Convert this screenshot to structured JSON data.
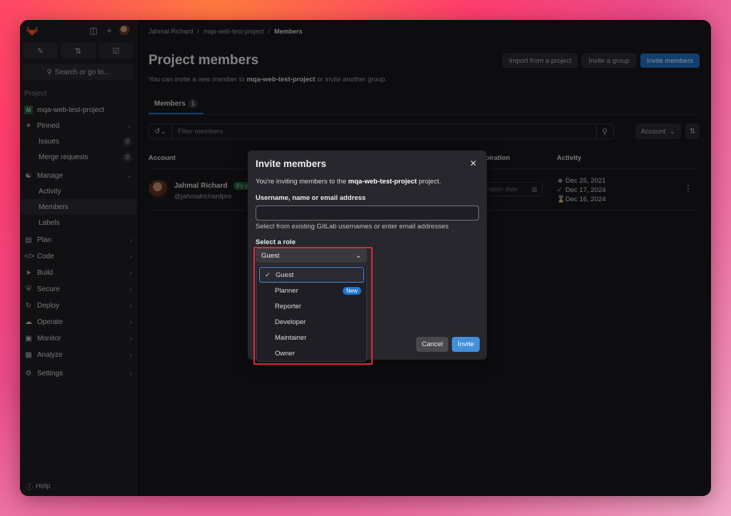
{
  "sidebar": {
    "search_label": "Search or go to...",
    "section_label": "Project",
    "project_name": "mqa-web-test-project",
    "project_initial": "M",
    "pinned_label": "Pinned",
    "issues_label": "Issues",
    "issues_count": "0",
    "mr_label": "Merge requests",
    "mr_count": "0",
    "manage_label": "Manage",
    "activity_label": "Activity",
    "members_label": "Members",
    "labels_label": "Labels",
    "plan_label": "Plan",
    "code_label": "Code",
    "build_label": "Build",
    "secure_label": "Secure",
    "deploy_label": "Deploy",
    "operate_label": "Operate",
    "monitor_label": "Monitor",
    "analyze_label": "Analyze",
    "settings_label": "Settings",
    "help_label": "Help"
  },
  "breadcrumb": {
    "user": "Jahmal Richard",
    "project": "mqa-web-test-project",
    "current": "Members"
  },
  "header": {
    "title": "Project members",
    "import_label": "Import from a project",
    "invite_group_label": "Invite a group",
    "invite_members_label": "Invite members",
    "subtitle_pre": "You can invite a new member to ",
    "subtitle_project": "mqa-web-test-project",
    "subtitle_post": " or invite another group."
  },
  "tabs": {
    "members_label": "Members",
    "members_count": "1"
  },
  "filter": {
    "placeholder": "Filter members",
    "sort_label": "Account"
  },
  "table": {
    "col_account": "Account",
    "col_expiration": "Expiration",
    "col_activity": "Activity",
    "row": {
      "name": "Jahmal Richard",
      "badge": "It's you",
      "username": "@jahmalrichardpro",
      "expiration_placeholder": "Expiration date",
      "activity_1": "Dec 25, 2021",
      "activity_2": "Dec 17, 2024",
      "activity_3": "Dec 16, 2024"
    }
  },
  "modal": {
    "title": "Invite members",
    "intro_pre": "You're inviting members to the ",
    "intro_project": "mqa-web-test-project",
    "intro_post": " project.",
    "username_label": "Username, name or email address",
    "username_hint": "Select from existing GitLab usernames or enter email addresses",
    "role_label": "Select a role",
    "selected_role": "Guest",
    "roles": [
      "Guest",
      "Planner",
      "Reporter",
      "Developer",
      "Maintainer",
      "Owner"
    ],
    "new_badge": "New",
    "cancel_label": "Cancel",
    "invite_label": "Invite"
  }
}
